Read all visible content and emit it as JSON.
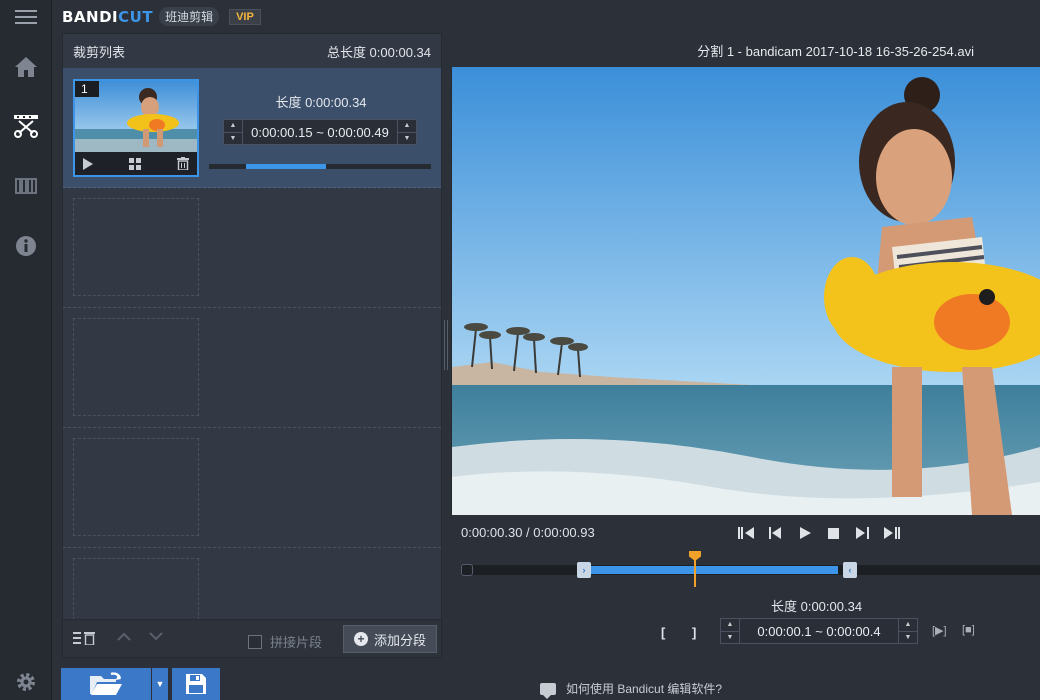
{
  "brand": {
    "logo_part1": "BANDI",
    "logo_part2": "CUT",
    "cn_name": "班迪剪辑",
    "vip": "VIP"
  },
  "left_panel": {
    "title": "裁剪列表",
    "total_length_label": "总长度 0:00:00.34",
    "segments": [
      {
        "number": "1",
        "length_label": "长度 0:00:00.34",
        "range": "0:00:00.15 ~ 0:00:00.49",
        "bar_fraction": 0.36
      }
    ],
    "footer": {
      "join_label": "拼接片段",
      "add_label": "添加分段"
    }
  },
  "player": {
    "file_title": "分割 1 - bandicam 2017-10-18 16-35-26-254.avi",
    "time_position": "0:00:00.30 / 0:00:00.93",
    "length_label": "长度 0:00:00.34",
    "range": "0:00:00.1  ~  0:00:00.4"
  },
  "bottom": {
    "help_text": "如何使用 Bandicut 编辑软件?"
  },
  "icons": {
    "rail": [
      "menu-icon",
      "home-icon",
      "cut-icon",
      "film-icon",
      "info-icon",
      "settings-icon"
    ]
  },
  "colors": {
    "accent": "#3c95e8",
    "vip": "#f5b73b",
    "playhead": "#f0a12a"
  }
}
